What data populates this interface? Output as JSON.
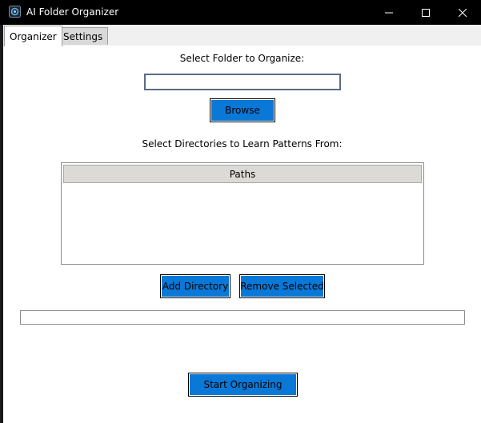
{
  "window": {
    "title": "AI Folder Organizer",
    "icon": "app-icon"
  },
  "tabs": [
    {
      "label": "Organizer",
      "active": true
    },
    {
      "label": "Settings",
      "active": false
    }
  ],
  "organizer": {
    "select_folder_label": "Select Folder to Organize:",
    "folder_value": "",
    "browse_label": "Browse",
    "learn_label": "Select Directories to Learn Patterns From:",
    "paths_header": "Paths",
    "paths": [],
    "add_directory_label": "Add Directory",
    "remove_selected_label": "Remove Selected",
    "progress": 0,
    "start_label": "Start Organizing"
  },
  "colors": {
    "button_bg": "#0a78d7",
    "titlebar_bg": "#000000"
  }
}
